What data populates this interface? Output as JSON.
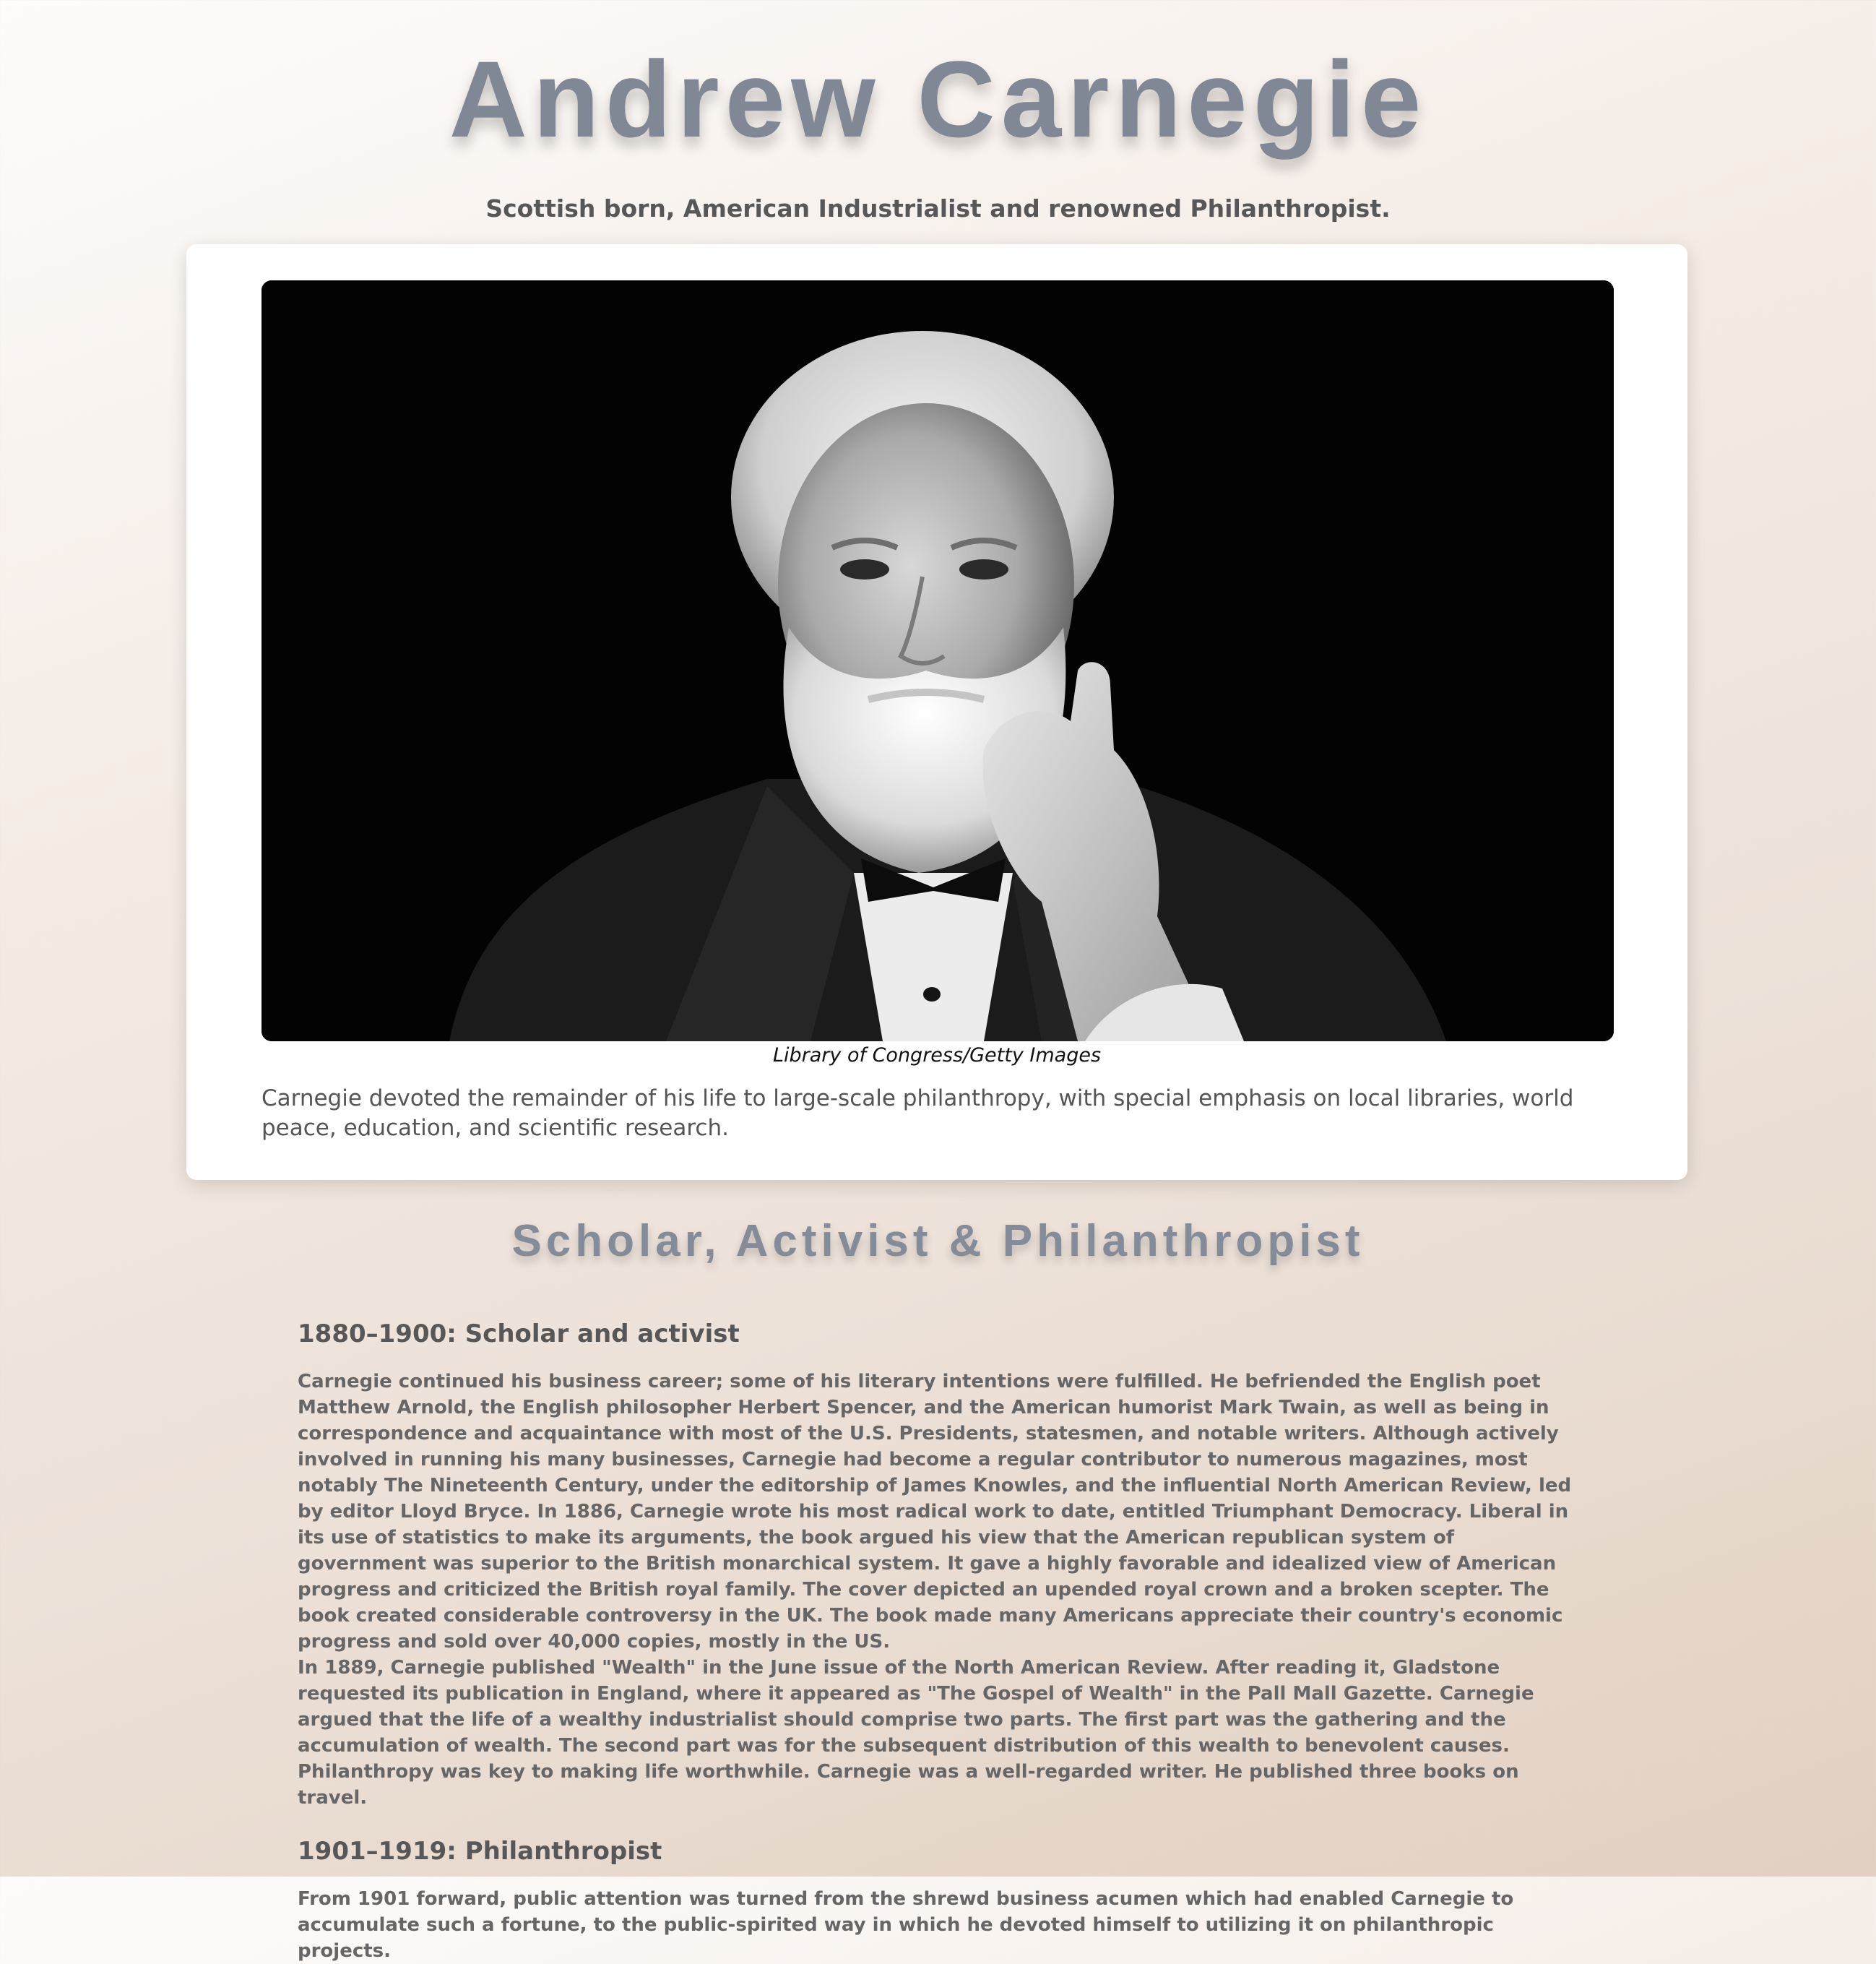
{
  "header": {
    "title": "Andrew Carnegie",
    "tagline": "Scottish born, American Industrialist and renowned Philanthropist."
  },
  "card": {
    "image_caption": "Library of Congress/Getty Images",
    "text": "Carnegie devoted the remainder of his life to large-scale philanthropy, with special emphasis on local libraries, world peace, education, and scientific research."
  },
  "section": {
    "title": "Scholar, Activist & Philanthropist",
    "subsections": [
      {
        "heading": "1880–1900: Scholar and activist",
        "paragraphs": [
          "Carnegie continued his business career; some of his literary intentions were fulfilled. He befriended the English poet Matthew Arnold, the English philosopher Herbert Spencer, and the American humorist Mark Twain, as well as being in correspondence and acquaintance with most of the U.S. Presidents, statesmen, and notable writers. Although actively involved in running his many businesses, Carnegie had become a regular contributor to numerous magazines, most notably The Nineteenth Century, under the editorship of James Knowles, and the influential North American Review, led by editor Lloyd Bryce. In 1886, Carnegie wrote his most radical work to date, entitled Triumphant Democracy. Liberal in its use of statistics to make its arguments, the book argued his view that the American republican system of government was superior to the British monarchical system. It gave a highly favorable and idealized view of American progress and criticized the British royal family. The cover depicted an upended royal crown and a broken scepter. The book created considerable controversy in the UK. The book made many Americans appreciate their country's economic progress and sold over 40,000 copies, mostly in the US.",
          "In 1889, Carnegie published \"Wealth\" in the June issue of the North American Review. After reading it, Gladstone requested its publication in England, where it appeared as \"The Gospel of Wealth\" in the Pall Mall Gazette. Carnegie argued that the life of a wealthy industrialist should comprise two parts. The first part was the gathering and the accumulation of wealth. The second part was for the subsequent distribution of this wealth to benevolent causes. Philanthropy was key to making life worthwhile. Carnegie was a well-regarded writer. He published three books on travel."
        ]
      },
      {
        "heading": "1901–1919: Philanthropist",
        "paragraphs": [
          "From 1901 forward, public attention was turned from the shrewd business acumen which had enabled Carnegie to accumulate such a fortune, to the public-spirited way in which he devoted himself to utilizing it on philanthropic projects."
        ]
      }
    ]
  }
}
